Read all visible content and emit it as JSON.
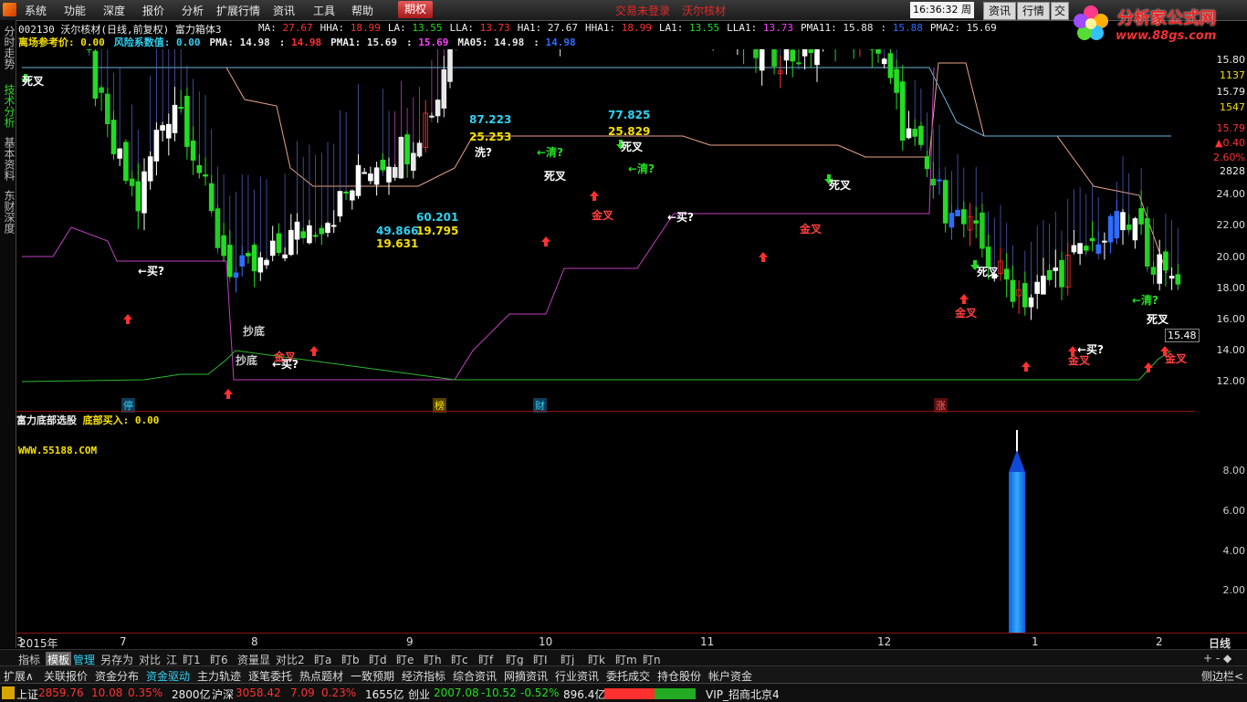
{
  "menubar": {
    "items": [
      "系统",
      "功能",
      "深度",
      "报价",
      "分析",
      "扩展行情",
      "资讯",
      "工具",
      "帮助"
    ],
    "active": "期权",
    "trade_status": "交易未登录",
    "stock_name": "沃尔核材",
    "clock": "16:36:32",
    "weekday": "周四",
    "buttons": [
      "资讯",
      "行情",
      "交"
    ]
  },
  "brand": {
    "name": "分析家公式网",
    "url": "www.88gs.com"
  },
  "leftbar": [
    "分时走势",
    "技术分析",
    "基本资料",
    "东财深度"
  ],
  "info": {
    "line1_prefix": "002130 沃尔核材(日线,前复权) 富力箱体3",
    "line1": [
      {
        "label": "MA:",
        "value": "27.67",
        "color": "#ff3030"
      },
      {
        "label": "HHA:",
        "value": "18.99",
        "color": "#ff3030"
      },
      {
        "label": "LA:",
        "value": "13.55",
        "color": "#22dd22"
      },
      {
        "label": "LLA:",
        "value": "13.73",
        "color": "#ff3030"
      },
      {
        "label": "HA1:",
        "value": "27.67",
        "color": "#e8e8e8"
      },
      {
        "label": "HHA1:",
        "value": "18.99",
        "color": "#ff3030"
      },
      {
        "label": "LA1:",
        "value": "13.55",
        "color": "#22dd22"
      },
      {
        "label": "LLA1:",
        "value": "13.73",
        "color": "#ff40ff"
      },
      {
        "label": "PMA11:",
        "value": "15.88",
        "color": "#e8e8e8"
      },
      {
        "label": ":",
        "value": "15.88",
        "color": "#2f6cff"
      },
      {
        "label": "PMA2:",
        "value": "15.69",
        "color": "#e8e8e8"
      }
    ],
    "line2": [
      {
        "label": "离场参考价:",
        "value": "0.00",
        "color": "#f5e000"
      },
      {
        "label": "风险系数值:",
        "value": "0.00",
        "color": "#2fd2f2"
      },
      {
        "label": "PMA:",
        "value": "14.98",
        "color": "#e8e8e8"
      },
      {
        "label": ":",
        "value": "14.98",
        "color": "#ff3030"
      },
      {
        "label": "PMA1:",
        "value": "15.69",
        "color": "#e8e8e8"
      },
      {
        "label": ":",
        "value": "15.69",
        "color": "#ff40ff"
      },
      {
        "label": "MA05:",
        "value": "14.98",
        "color": "#e8e8e8"
      },
      {
        "label": ":",
        "value": "14.98",
        "color": "#2f6cff"
      }
    ],
    "sub_title": "富力底部选股",
    "sub_label": "底部买入:",
    "sub_value": "0.00",
    "watermark": "WWW.55188.COM"
  },
  "right_axis": {
    "top_values": [
      "15.80",
      "1137",
      "15.79",
      "1547",
      "15.79",
      "▲0.40",
      "2.60%",
      "2828"
    ],
    "top_colors": [
      "#eee",
      "#f5e000",
      "#eee",
      "#f5e000",
      "#ff3030",
      "#ff3030",
      "#ff3030",
      "#eee"
    ],
    "price_ticks": [
      "24.00",
      "22.00",
      "20.00",
      "18.00",
      "16.00",
      "14.00",
      "12.00"
    ],
    "current_price": "15.48",
    "sub_ticks": [
      "8.00",
      "6.00",
      "4.00",
      "2.00"
    ]
  },
  "x_axis": {
    "labels": [
      "2015年",
      "7",
      "8",
      "9",
      "10",
      "11",
      "12",
      "1",
      "2",
      "3"
    ],
    "period": "日线"
  },
  "annotations": {
    "dead_cross": "死叉",
    "gold_cross": "金叉",
    "buy": "←买?",
    "sell": "←清?",
    "wash": "洗?",
    "bottom": "抄底",
    "peak_values": [
      "87.223",
      "25.253",
      "77.825",
      "25.829",
      "49.866",
      "19.631",
      "60.201",
      "19.795"
    ],
    "events": [
      "停",
      "榜",
      "财",
      "涨"
    ]
  },
  "tabs": [
    "指标",
    "模板",
    "管理",
    "另存为",
    "对比",
    "江",
    "盯1",
    "盯6",
    "资量显",
    "对比2",
    "盯a",
    "盯b",
    "盯d",
    "盯e",
    "盯h",
    "盯c",
    "盯f",
    "盯g",
    "盯I",
    "盯j",
    "盯k",
    "盯m",
    "盯n"
  ],
  "tabs_right": "+ - ◆",
  "funcbar": [
    "扩展∧",
    "关联报价",
    "资金分布",
    "资金驱动",
    "主力轨迹",
    "逐笔委托",
    "热点题材",
    "一致预期",
    "经济指标",
    "综合资讯",
    "网摘资讯",
    "行业资讯",
    "委托成交",
    "持仓股份",
    "帐户资金"
  ],
  "funcbar_right": "侧边栏<",
  "status": {
    "sh_label": "上证",
    "sh_val": "2859.76",
    "sh_chg": "10.08",
    "sh_pct": "0.35%",
    "sh_amt": "2800亿",
    "hs_label": "沪深",
    "hs_val": "3058.42",
    "hs_chg": "7.09",
    "hs_pct": "0.23%",
    "hs_amt": "1655亿",
    "cy_label": "创业",
    "cy_val": "2007.08",
    "cy_chg": "-10.52",
    "cy_pct": "-0.52%",
    "cy_amt": "896.4亿",
    "server": "VIP_招商北京4"
  }
}
